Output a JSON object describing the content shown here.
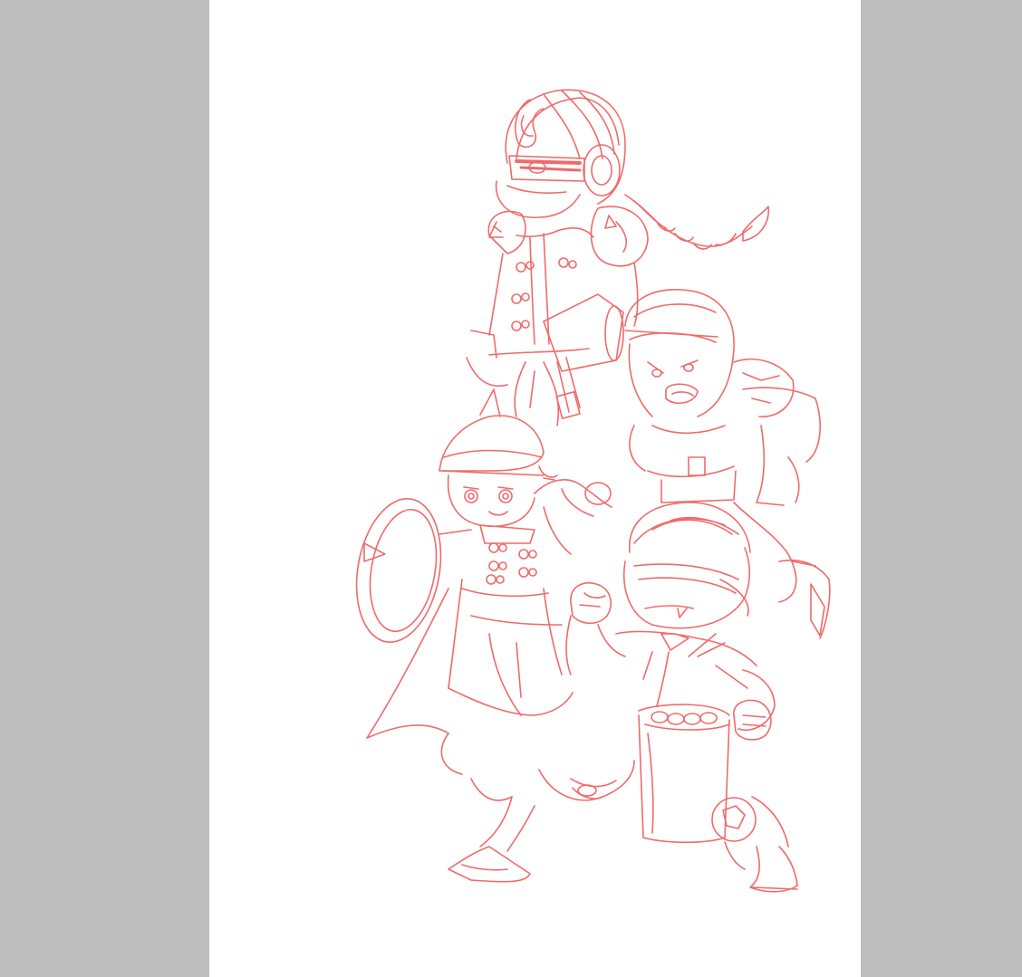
{
  "colors": {
    "sidebar": "#bdbdbd",
    "canvas": "#ffffff",
    "line": "#f06a6a"
  },
  "canvas": {
    "content": "sketch-artwork"
  }
}
